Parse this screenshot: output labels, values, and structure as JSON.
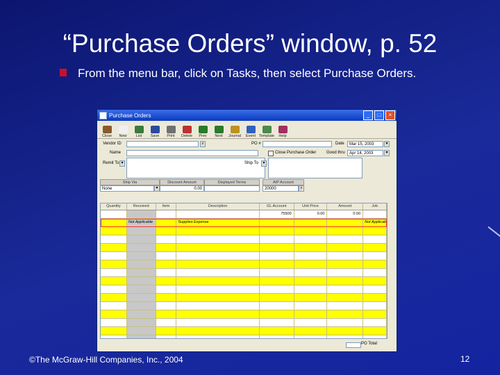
{
  "slide": {
    "title": "“Purchase Orders” window, p. 52",
    "bullet": "From the menu bar, click on Tasks, then select Purchase Orders.",
    "footer": "©The McGraw-Hill Companies, Inc., 2004",
    "page_number": "12",
    "bullet_color": "#c8102e"
  },
  "window": {
    "title": "Purchase Orders",
    "minimize": "_",
    "maximize": "□",
    "close": "×",
    "toolbar": [
      {
        "label": "Close",
        "icon": "close-door-icon",
        "color": "#8a5a2a"
      },
      {
        "label": "New",
        "icon": "new-document-icon",
        "color": "#f0f0f0"
      },
      {
        "label": "List",
        "icon": "list-icon",
        "color": "#3a7a3a"
      },
      {
        "label": "Save",
        "icon": "save-disk-icon",
        "color": "#2a4aa0"
      },
      {
        "label": "Print",
        "icon": "printer-icon",
        "color": "#707070"
      },
      {
        "label": "Delete",
        "icon": "delete-icon",
        "color": "#c03030"
      },
      {
        "label": "Prev",
        "icon": "previous-arrow-icon",
        "color": "#2a7a2a"
      },
      {
        "label": "Next",
        "icon": "next-arrow-icon",
        "color": "#2a7a2a"
      },
      {
        "label": "Journal",
        "icon": "journal-icon",
        "color": "#c09020"
      },
      {
        "label": "Event",
        "icon": "event-icon",
        "color": "#3060c0"
      },
      {
        "label": "Template",
        "icon": "template-icon",
        "color": "#4a8a4a"
      },
      {
        "label": "Help",
        "icon": "help-icon",
        "color": "#a03060"
      }
    ],
    "form": {
      "vendor_label": "Vendor ID",
      "name_label": "Name",
      "remit_label": "Remit To",
      "po_label": "PO #",
      "date_label": "Date",
      "date_value": "Mar 15, 2003",
      "close_po_label": "Close Purchase Order",
      "good_thru_label": "Good thru",
      "good_thru_value": "Apr 14, 2003",
      "ship_to_label": "Ship To",
      "ship_via_header": "Ship Via",
      "ship_via_value": "None",
      "discount_header": "Discount Amount",
      "discount_value": "0.00",
      "displayed_terms_header": "Displayed Terms",
      "ap_account_header": "A/P Account",
      "ap_account_value": "20000"
    },
    "grid": {
      "columns": [
        "Quantity",
        "Received",
        "Item",
        "Description",
        "GL Account",
        "Unit Price",
        "Amount",
        "Job"
      ],
      "rows": [
        {
          "quantity": "",
          "received": "",
          "item": "",
          "description": "",
          "gl": "75500",
          "unit_price": "0.00",
          "amount": "0.00",
          "job": ""
        },
        {
          "quantity": "",
          "received": "Not Applicable",
          "item": "",
          "description": "Supplies Expense",
          "gl": "",
          "unit_price": "",
          "amount": "",
          "job": "Not Applicable"
        }
      ],
      "empty_rows": 16,
      "total_label": "PO Total"
    }
  }
}
